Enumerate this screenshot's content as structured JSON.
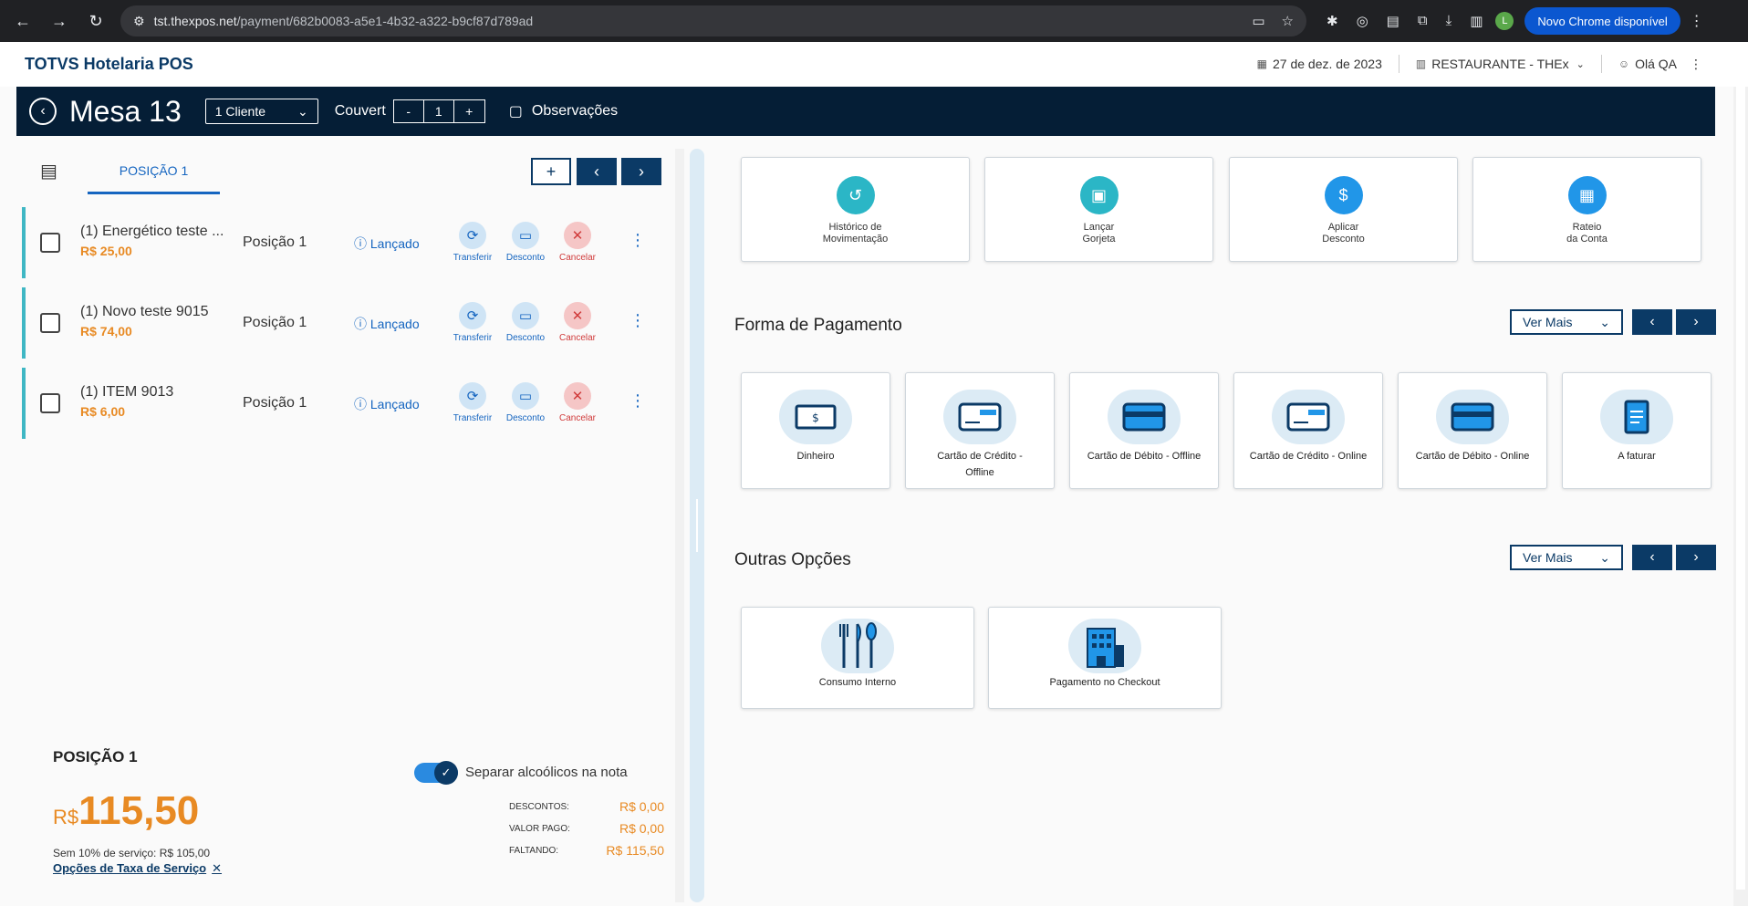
{
  "browser": {
    "url_host": "tst.thexpos.net",
    "url_path": "/payment/682b0083-a5e1-4b32-a322-b9cf87d789ad",
    "avatar_letter": "L",
    "update_label": "Novo Chrome disponível"
  },
  "header": {
    "brand": "TOTVS Hotelaria POS",
    "date": "27 de dez. de 2023",
    "location": "RESTAURANTE - THEx",
    "user": "Olá QA"
  },
  "mesa": {
    "title": "Mesa 13",
    "client_select": "1 Cliente",
    "couvert_label": "Couvert",
    "couvert_minus": "-",
    "couvert_value": "1",
    "couvert_plus": "+",
    "observacoes": "Observações"
  },
  "tabs": {
    "position_tab": "POSIÇÃO 1",
    "add": "+",
    "prev": "‹",
    "next": "›"
  },
  "items": [
    {
      "name": "(1)  Energético teste ...",
      "price": "R$ 25,00",
      "position": "Posição 1",
      "status": "Lançado"
    },
    {
      "name": "(1)  Novo teste 9015",
      "price": "R$ 74,00",
      "position": "Posição 1",
      "status": "Lançado"
    },
    {
      "name": "(1) ITEM 9013",
      "price": "R$ 6,00",
      "position": "Posição 1",
      "status": "Lançado"
    }
  ],
  "item_actions": {
    "transferir": "Transferir",
    "desconto": "Desconto",
    "cancelar": "Cancelar"
  },
  "summary": {
    "title": "POSIÇÃO 1",
    "currency": "R$",
    "total": "115,50",
    "sem_servico": "Sem 10% de serviço: R$ 105,00",
    "opcoes_link": "Opções de Taxa de Serviço",
    "toggle_label": "Separar alcoólicos na nota",
    "descontos_label": "DESCONTOS:",
    "descontos_value": "R$ 0,00",
    "valor_pago_label": "VALOR PAGO:",
    "valor_pago_value": "R$ 0,00",
    "faltando_label": "FALTANDO:",
    "faltando_value": "R$ 115,50"
  },
  "top_actions": [
    {
      "line1": "Histórico de",
      "line2": "Movimentação"
    },
    {
      "line1": "Lançar",
      "line2": "Gorjeta"
    },
    {
      "line1": "Aplicar",
      "line2": "Desconto"
    },
    {
      "line1": "Rateio",
      "line2": "da Conta"
    }
  ],
  "payment": {
    "title": "Forma de Pagamento",
    "ver_mais": "Ver Mais",
    "methods": [
      {
        "line1": "Dinheiro",
        "line2": ""
      },
      {
        "line1": "Cartão de Crédito -",
        "line2": "Offline"
      },
      {
        "line1": "Cartão de Débito - Offline",
        "line2": ""
      },
      {
        "line1": "Cartão de Crédito - Online",
        "line2": ""
      },
      {
        "line1": "Cartão de Débito - Online",
        "line2": ""
      },
      {
        "line1": "A faturar",
        "line2": ""
      }
    ]
  },
  "others": {
    "title": "Outras Opções",
    "ver_mais": "Ver Mais",
    "options": [
      {
        "label": "Consumo Interno"
      },
      {
        "label": "Pagamento no Checkout"
      }
    ]
  },
  "colors": {
    "navy": "#051e36",
    "accent": "#0b3a66",
    "orange": "#e88a23",
    "teal": "#2bb6c6",
    "link": "#1565c0"
  }
}
